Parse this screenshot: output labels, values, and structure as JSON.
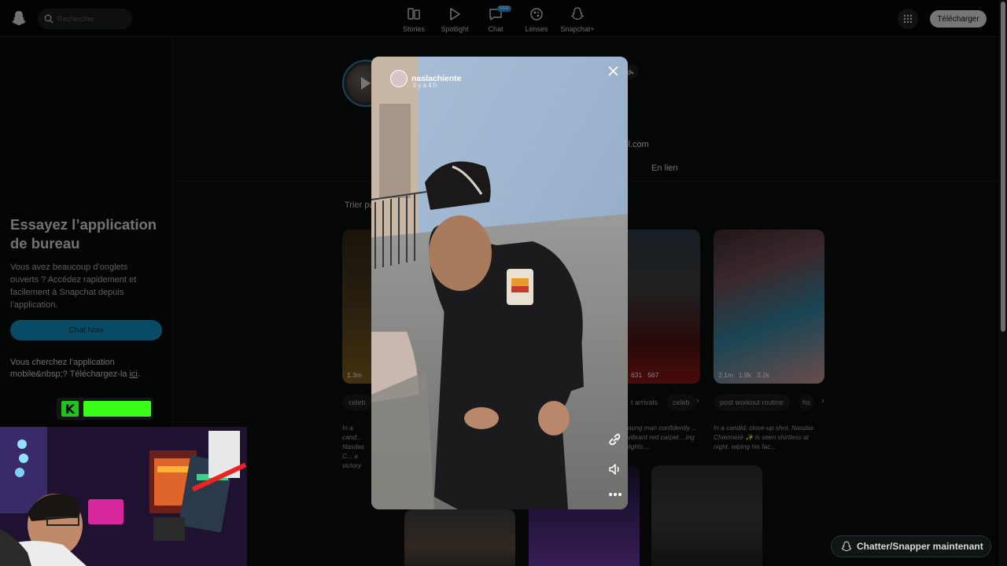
{
  "topbar": {
    "search_placeholder": "Rechercher",
    "nav": [
      {
        "label": "Stories",
        "icon": "stories-icon"
      },
      {
        "label": "Spotlight",
        "icon": "spotlight-play-icon"
      },
      {
        "label": "Chat",
        "icon": "chat-icon",
        "badge": "NEW"
      },
      {
        "label": "Lenses",
        "icon": "lenses-icon"
      },
      {
        "label": "Snapchat+",
        "icon": "snapchat-plus-icon"
      }
    ],
    "download_label": "Télécharger"
  },
  "sidebar": {
    "promo_title": "Essayez l’application de bureau",
    "promo_text": "Vous avez beaucoup d’onglets ouverts ? Accédez rapidement et facilement à Snapchat depuis l’application.",
    "chat_now_label": "Chat Now",
    "mobile_text": "Vous cherchez l’application mobile&nbsp;? Téléchargez-la",
    "mobile_link": "ici",
    "mobile_end": "."
  },
  "profile": {
    "email_tail": "il.com",
    "tab_link": "En lien",
    "sort_label": "Trier pa"
  },
  "cards": [
    {
      "stats": [
        "1.3m"
      ],
      "tag": "celeb",
      "caption": "In a cand... Nasdas C... a victory"
    },
    {
      "stats": [
        "631",
        "567"
      ],
      "tag": "t arrivals",
      "tag2": "celeb",
      "caption": "oung man confidently ... vibrant red carpet ...ing lights...."
    },
    {
      "stats": [
        "2.1m",
        "1.9k",
        "3.2k"
      ],
      "tag": "post workout routine",
      "tag2": "ho",
      "caption": "In a candid, close-up shot, Nasdas Chienneté ✨ is seen shirtless at night, wiping his fac..."
    }
  ],
  "modal": {
    "username": "naslachiente",
    "time": "Il y a 4 h"
  },
  "chat_snap_label": "Chatter/Snapper maintenant",
  "colors": {
    "accent": "#0e8ab6",
    "kick_green": "#3cfc1c"
  }
}
